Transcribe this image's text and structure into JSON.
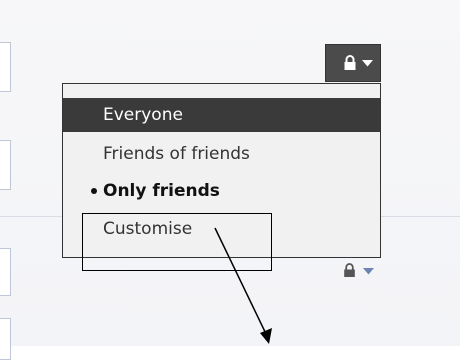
{
  "privacy_menu": {
    "button_lock_icon": "lock-icon",
    "button_caret_icon": "caret-down-icon",
    "items": [
      {
        "label": "Everyone",
        "state": "highlighted"
      },
      {
        "label": "Friends of friends",
        "state": "normal"
      },
      {
        "label": "Only friends",
        "state": "selected"
      },
      {
        "label": "Customise",
        "state": "normal"
      }
    ]
  },
  "row_privacy_icon": {
    "lock_icon": "lock-icon",
    "caret_icon": "caret-down-icon"
  },
  "colors": {
    "button_bg": "#4b4b4b",
    "highlight_bg": "#3a3a3a",
    "menu_bg": "#f1f1f1",
    "caret_blue": "#6d84b4",
    "field_border": "#bdc7d8"
  }
}
